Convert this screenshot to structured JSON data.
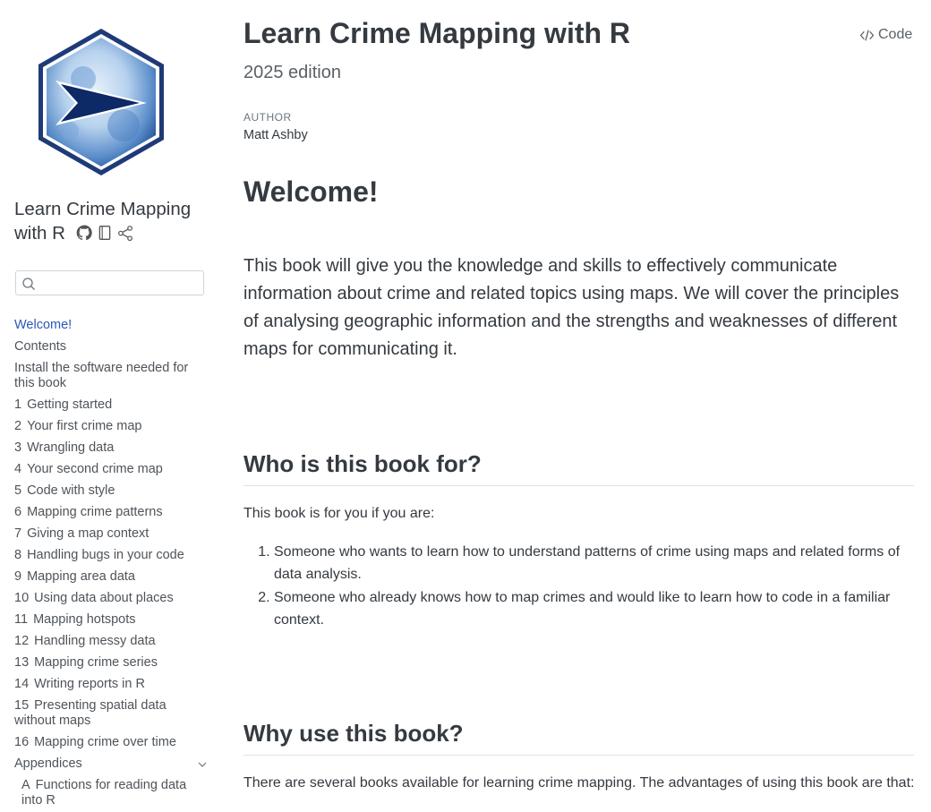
{
  "sidebar": {
    "title": "Learn Crime Mapping with R",
    "icons": [
      "github-icon",
      "notebook-icon",
      "share-icon"
    ],
    "search": {
      "placeholder": "",
      "value": ""
    },
    "nav": [
      {
        "num": "",
        "label": "Welcome!",
        "active": true
      },
      {
        "num": "",
        "label": "Contents"
      },
      {
        "num": "",
        "label": "Install the software needed for this book"
      },
      {
        "num": "1",
        "label": "Getting started"
      },
      {
        "num": "2",
        "label": "Your first crime map"
      },
      {
        "num": "3",
        "label": "Wrangling data"
      },
      {
        "num": "4",
        "label": "Your second crime map"
      },
      {
        "num": "5",
        "label": "Code with style"
      },
      {
        "num": "6",
        "label": "Mapping crime patterns"
      },
      {
        "num": "7",
        "label": "Giving a map context"
      },
      {
        "num": "8",
        "label": "Handling bugs in your code"
      },
      {
        "num": "9",
        "label": "Mapping area data"
      },
      {
        "num": "10",
        "label": "Using data about places"
      },
      {
        "num": "11",
        "label": "Mapping hotspots"
      },
      {
        "num": "12",
        "label": "Handling messy data"
      },
      {
        "num": "13",
        "label": "Mapping crime series"
      },
      {
        "num": "14",
        "label": "Writing reports in R"
      },
      {
        "num": "15",
        "label": "Presenting spatial data without maps"
      },
      {
        "num": "16",
        "label": "Mapping crime over time"
      }
    ],
    "appendices_label": "Appendices",
    "appendix_items": [
      {
        "num": "A",
        "label": "Functions for reading data into R"
      }
    ]
  },
  "header": {
    "code_button": "Code",
    "title": "Learn Crime Mapping with R",
    "subtitle": "2025 edition",
    "author_label": "AUTHOR",
    "author_name": "Matt Ashby"
  },
  "content": {
    "welcome_heading": "Welcome!",
    "lead": "This book will give you the knowledge and skills to effectively communicate information about crime and related topics using maps. We will cover the principles of analysing geographic information and the strengths and weaknesses of different maps for communicating it.",
    "who_heading": "Who is this book for?",
    "who_intro": "This book is for you if you are:",
    "who_list": [
      "Someone who wants to learn how to understand patterns of crime using maps and related forms of data analysis.",
      "Someone who already knows how to map crimes and would like to learn how to code in a familiar context."
    ],
    "why_heading": "Why use this book?",
    "why_intro": "There are several books available for learning crime mapping. The advantages of using this book are that:"
  },
  "colors": {
    "active_link": "#2b59b5",
    "logo_dark": "#1e3a78",
    "logo_light": "#9ec4e6"
  }
}
